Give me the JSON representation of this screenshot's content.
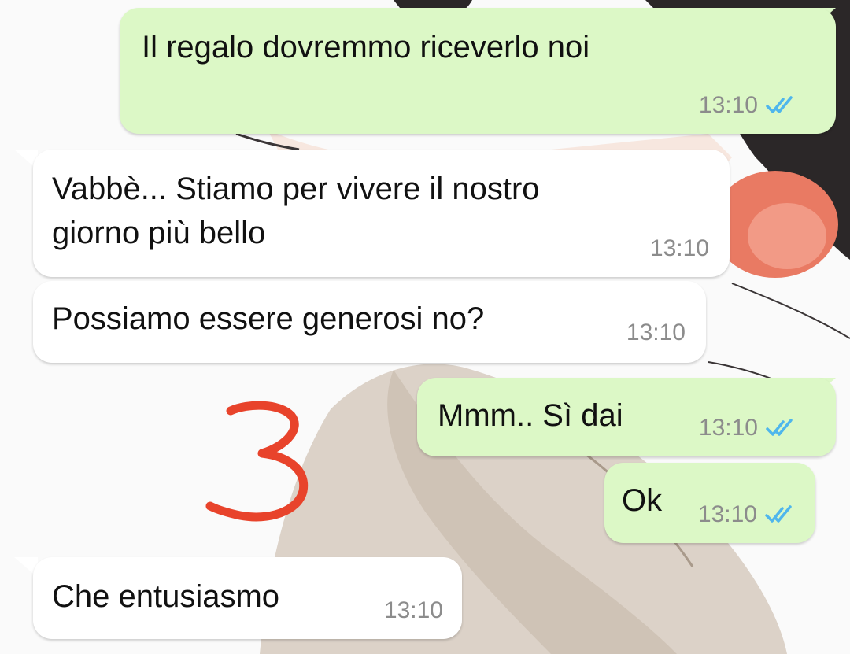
{
  "annotation": {
    "number": "3",
    "color": "#e8432b"
  },
  "colors": {
    "outgoing_bubble": "#dcf8c6",
    "incoming_bubble": "#ffffff",
    "read_ticks": "#4fb6ec",
    "timestamp": "#8c8c8c"
  },
  "messages": [
    {
      "direction": "out",
      "text": "Il regalo dovremmo riceverlo noi",
      "time": "13:10",
      "status": "read"
    },
    {
      "direction": "in",
      "text_line1": "Vabbè... Stiamo per vivere il nostro",
      "text_line2": "giorno più bello",
      "time": "13:10"
    },
    {
      "direction": "in",
      "text": "Possiamo essere generosi no?",
      "time": "13:10"
    },
    {
      "direction": "out",
      "text": "Mmm.. Sì dai",
      "time": "13:10",
      "status": "read"
    },
    {
      "direction": "out",
      "text": "Ok",
      "time": "13:10",
      "status": "read"
    },
    {
      "direction": "in",
      "text": "Che entusiasmo",
      "time": "13:10"
    }
  ]
}
